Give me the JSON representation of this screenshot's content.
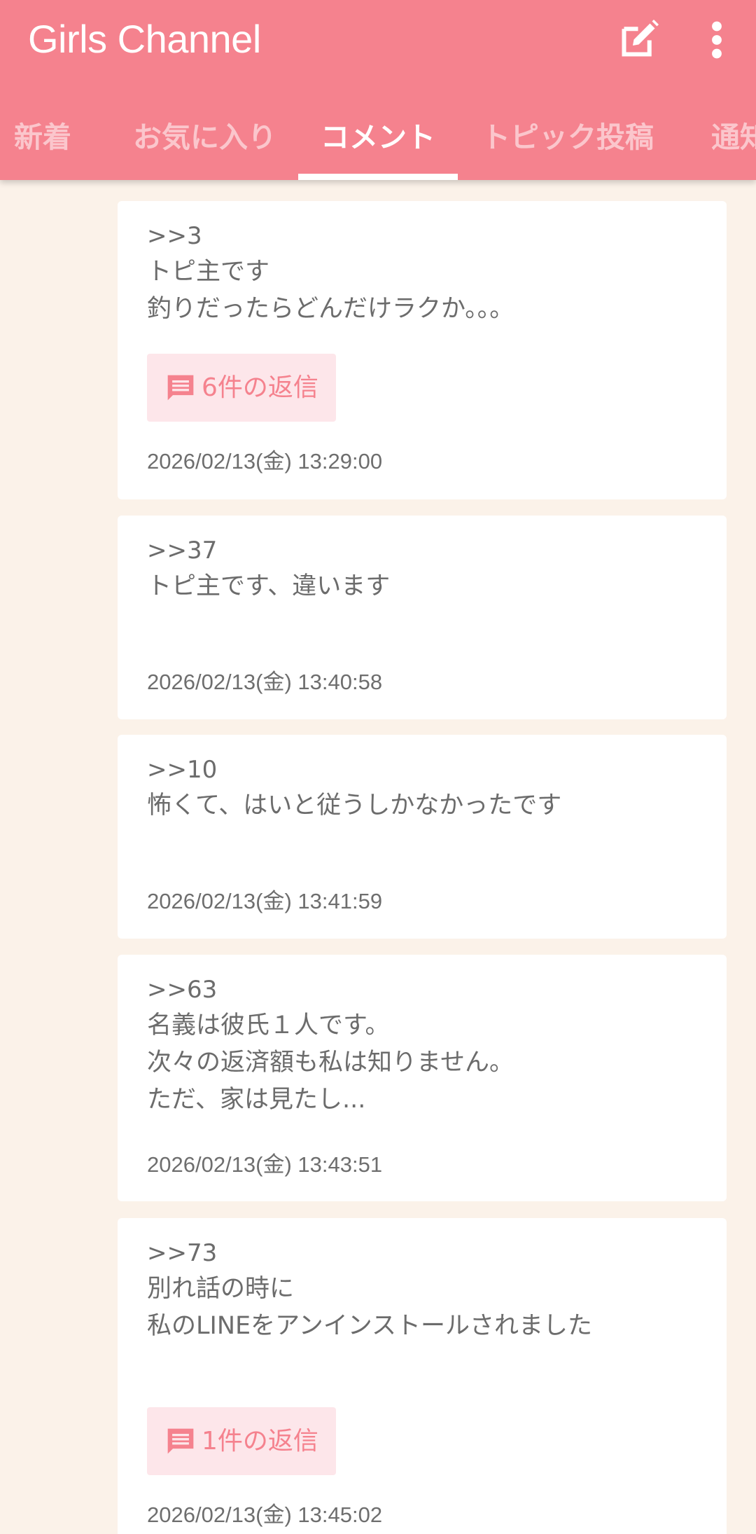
{
  "app": {
    "title": "Girls Channel",
    "accent_color": "#f5828e",
    "background_color": "#fbf2e9"
  },
  "toolbar": {
    "edit_icon": "edit-note-icon",
    "more_icon": "more-vertical-icon"
  },
  "tabs": [
    {
      "label": "新着",
      "active": false
    },
    {
      "label": "お気に入り",
      "active": false
    },
    {
      "label": "コメント",
      "active": true
    },
    {
      "label": "トピック投稿",
      "active": false
    },
    {
      "label": "通知",
      "active": false
    }
  ],
  "comments": [
    {
      "ref": ">>3",
      "lines": [
        "トピ主です",
        "釣りだったらどんだけラクか。。。"
      ],
      "reply_label": "6件の返信",
      "timestamp": "2026/02/13(金) 13:29:00"
    },
    {
      "ref": ">>37",
      "lines": [
        "トピ主です、違います"
      ],
      "timestamp": "2026/02/13(金) 13:40:58"
    },
    {
      "ref": ">>10",
      "lines": [
        "怖くて、はいと従うしかなかったです"
      ],
      "timestamp": "2026/02/13(金) 13:41:59"
    },
    {
      "ref": ">>63",
      "lines": [
        "名義は彼氏１人です。",
        "次々の返済額も私は知りません。",
        "ただ、家は見たし..."
      ],
      "timestamp": "2026/02/13(金) 13:43:51"
    },
    {
      "ref": ">>73",
      "lines": [
        "別れ話の時に",
        "私のLINEをアンインストールされました"
      ],
      "reply_label": "1件の返信",
      "timestamp": "2026/02/13(金) 13:45:02"
    }
  ]
}
